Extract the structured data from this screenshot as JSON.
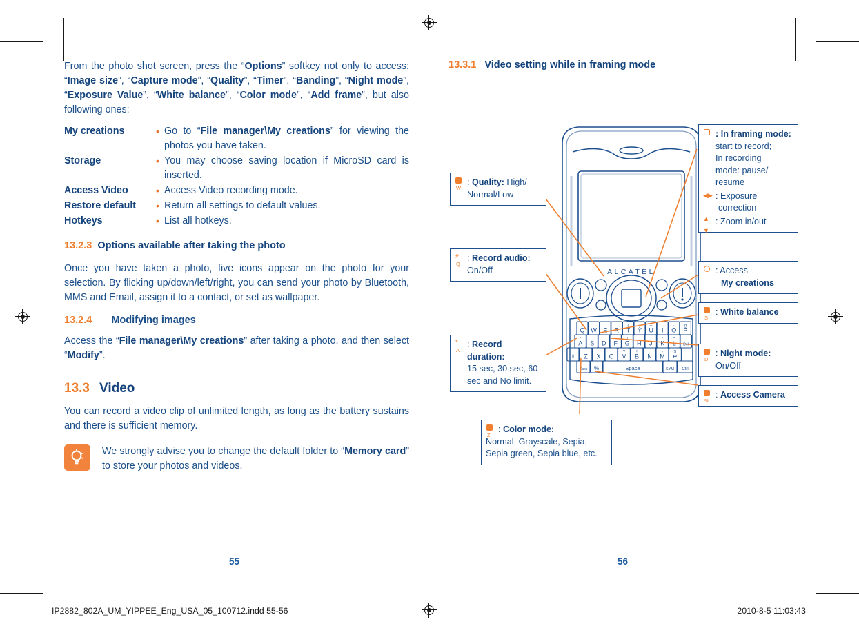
{
  "left_column": {
    "intro_paragraph": {
      "segments": [
        {
          "t": "From the photo shot screen, press the “",
          "b": false
        },
        {
          "t": "Options",
          "b": true
        },
        {
          "t": "” softkey not only to access: “",
          "b": false
        },
        {
          "t": "Image size",
          "b": true
        },
        {
          "t": "”, “",
          "b": false
        },
        {
          "t": "Capture mode",
          "b": true
        },
        {
          "t": "”, “",
          "b": false
        },
        {
          "t": "Quality",
          "b": true
        },
        {
          "t": "”, “",
          "b": false
        },
        {
          "t": "Timer",
          "b": true
        },
        {
          "t": "”, “",
          "b": false
        },
        {
          "t": "Banding",
          "b": true
        },
        {
          "t": "”, “",
          "b": false
        },
        {
          "t": "Night mode",
          "b": true
        },
        {
          "t": "”, “",
          "b": false
        },
        {
          "t": "Exposure Value",
          "b": true
        },
        {
          "t": "”, “",
          "b": false
        },
        {
          "t": "White balance",
          "b": true
        },
        {
          "t": "”, “",
          "b": false
        },
        {
          "t": "Color mode",
          "b": true
        },
        {
          "t": "”, “",
          "b": false
        },
        {
          "t": "Add frame",
          "b": true
        },
        {
          "t": "”, but also following ones:",
          "b": false
        }
      ]
    },
    "definitions": [
      {
        "term": "My creations",
        "bullet": "•",
        "segments": [
          {
            "t": "Go to “",
            "b": false
          },
          {
            "t": "File manager\\My creations",
            "b": true
          },
          {
            "t": "” for viewing the photos you have taken.",
            "b": false
          }
        ]
      },
      {
        "term": "Storage",
        "bullet": "•",
        "segments": [
          {
            "t": "You may choose saving location if MicroSD card is inserted.",
            "b": false
          }
        ]
      },
      {
        "term": "Access Video",
        "bullet": "•",
        "segments": [
          {
            "t": "Access Video recording mode.",
            "b": false
          }
        ]
      },
      {
        "term": "Restore default",
        "bullet": "•",
        "segments": [
          {
            "t": "Return all settings to default values.",
            "b": false
          }
        ]
      },
      {
        "term": "Hotkeys",
        "bullet": "•",
        "segments": [
          {
            "t": "List all hotkeys.",
            "b": false
          }
        ]
      }
    ],
    "heading_13_2_3": {
      "number": "13.2.3",
      "title": "Options available after taking the photo"
    },
    "paragraph_13_2_3": "Once you have taken a photo, five icons appear on the photo for your selection. By flicking up/down/left/right, you can send your photo by Bluetooth, MMS and Email, assign it to a contact, or set as wallpaper.",
    "heading_13_2_4": {
      "number": "13.2.4",
      "title": "Modifying images"
    },
    "paragraph_13_2_4": {
      "segments": [
        {
          "t": "Access the “",
          "b": false
        },
        {
          "t": "File manager\\My creations",
          "b": true
        },
        {
          "t": "” after taking a photo, and then select “",
          "b": false
        },
        {
          "t": "Modify",
          "b": true
        },
        {
          "t": "”.",
          "b": false
        }
      ]
    },
    "heading_13_3": {
      "number": "13.3",
      "title": "Video"
    },
    "paragraph_13_3": "You can record a video clip of unlimited length, as long as the battery sustains and there is sufficient memory.",
    "tip": {
      "icon": "lightbulb-icon",
      "segments": [
        {
          "t": "We strongly advise you to change the default folder to “",
          "b": false
        },
        {
          "t": "Memory card",
          "b": true
        },
        {
          "t": "” to store your photos and videos.",
          "b": false
        }
      ]
    },
    "page_number": "55"
  },
  "right_column": {
    "heading_13_3_1": {
      "number": "13.3.1",
      "title": "Video setting while in framing mode"
    },
    "page_number": "56"
  },
  "diagram": {
    "device_brand": "ALCATEL",
    "keyboard": {
      "row1": [
        "Q",
        "W",
        "E",
        "R",
        "T",
        "Y",
        "U",
        "I",
        "O",
        "P"
      ],
      "row1_alt": [
        "#",
        "",
        "",
        "",
        "(",
        ")",
        "–",
        "",
        "·",
        "@"
      ],
      "row2": [
        "A",
        "S",
        "D",
        "F",
        "G",
        "H",
        "J",
        "K",
        "L",
        "Del"
      ],
      "row2_alt": [
        "*",
        "",
        "",
        "",
        "/",
        ":",
        ";",
        "'",
        "\"",
        ""
      ],
      "row3": [
        "Z",
        "X",
        "C",
        "V",
        "B",
        "N",
        "M",
        "↵"
      ],
      "row3_alt": [
        "",
        "",
        "",
        "?",
        "!",
        ",",
        "-",
        "$"
      ],
      "row4": [
        "Caps",
        "%",
        "Space",
        "SYM",
        "Ctrl"
      ],
      "shift_key": "⇧"
    },
    "callouts": [
      {
        "id": "framing-mode",
        "key_glyph": "hollow-square",
        "key_letter": "",
        "lines": [
          {
            "prefix": ": ",
            "bold": "In framing mode:",
            "rest": ""
          },
          {
            "prefix": "",
            "bold": "",
            "rest": "start to record;",
            "indent": true
          },
          {
            "prefix": "",
            "bold": "",
            "rest": "In recording",
            "indent": true
          },
          {
            "prefix": "",
            "bold": "",
            "rest": "mode: pause/",
            "indent": true
          },
          {
            "prefix": "",
            "bold": "",
            "rest": "resume",
            "indent": true
          }
        ],
        "extra_rows": [
          {
            "glyph": "left-right-arrows",
            "text": ": Exposure",
            "sub": "correction"
          },
          {
            "glyph": "up-down-arrows",
            "text": ": Zoom in/out",
            "sub": ""
          }
        ]
      },
      {
        "id": "quality",
        "key_glyph": "filled-square",
        "key_letter": "W",
        "label_bold": "Quality:",
        "label_rest": " High/",
        "line2": "Normal/Low"
      },
      {
        "id": "record-audio",
        "key_glyph": "hash",
        "key_letter": "Q",
        "label_bold": "Record audio:",
        "label_rest": "",
        "line2": "On/Off"
      },
      {
        "id": "record-duration",
        "key_glyph": "asterisk",
        "key_letter": "A",
        "label_bold": "Record duration:",
        "label_rest": "",
        "line2": "15 sec, 30 sec, 60",
        "line3": "sec and No limit."
      },
      {
        "id": "color-mode",
        "key_glyph": "filled-square",
        "key_letter": "Z",
        "label_bold": "Color mode:",
        "label_rest": "",
        "line2": "Normal, Grayscale, Sepia,",
        "line3": "Sepia green, Sepia blue, etc."
      },
      {
        "id": "my-creations",
        "key_glyph": "hollow-circle",
        "key_letter": "",
        "label_bold": "",
        "label_rest": ": Access",
        "line2_bold": "My creations"
      },
      {
        "id": "white-balance",
        "key_glyph": "filled-square",
        "key_letter": "S",
        "label_bold": "White balance",
        "label_rest": ""
      },
      {
        "id": "night-mode",
        "key_glyph": "filled-square",
        "key_letter": "D",
        "label_bold": "Night mode:",
        "label_rest": "",
        "line2": "On/Off"
      },
      {
        "id": "access-camera",
        "key_glyph": "filled-square",
        "key_letter": "%",
        "label_bold": "Access Camera",
        "label_rest": ""
      }
    ]
  },
  "print_bar": {
    "filename": "IP2882_802A_UM_YIPPEE_Eng_USA_05_100712.indd   55-56",
    "timestamp": "2010-8-5   11:03:43"
  }
}
